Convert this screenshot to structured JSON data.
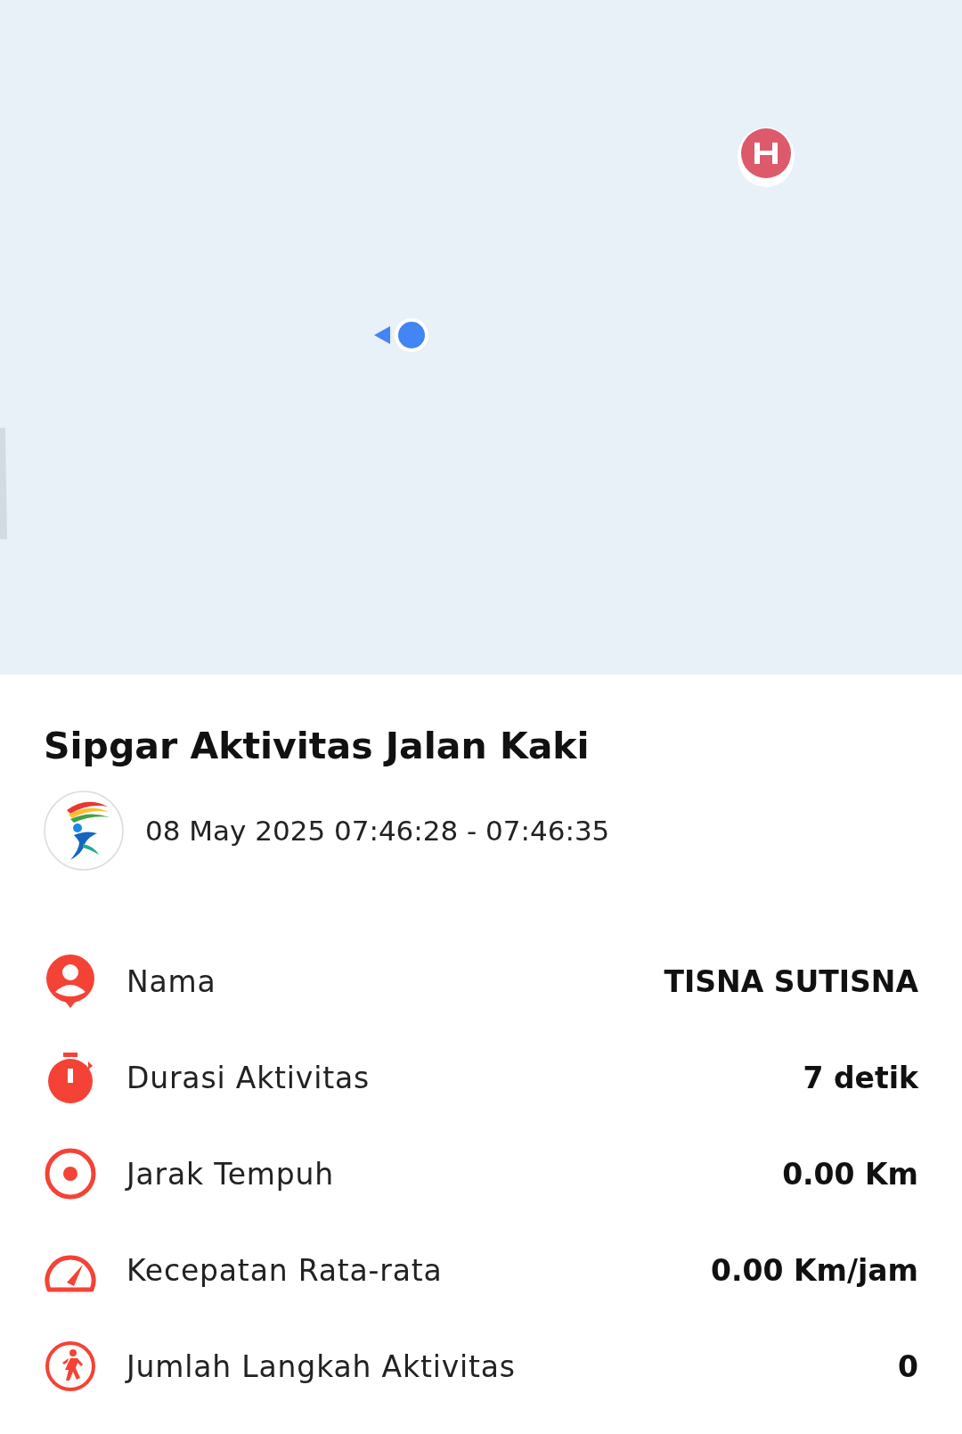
{
  "activity": {
    "title": "Sipgar Aktivitas Jalan Kaki",
    "time_range": "08 May 2025 07:46:28 - 07:46:35"
  },
  "stats": [
    {
      "kind": "person",
      "label": "Nama",
      "value": "TISNA SUTISNA"
    },
    {
      "kind": "timer",
      "label": "Durasi Aktivitas",
      "value": "7 detik"
    },
    {
      "kind": "distance",
      "label": "Jarak Tempuh",
      "value": "0.00 Km"
    },
    {
      "kind": "speed",
      "label": "Kecepatan Rata-rata",
      "value": "0.00 Km/jam"
    },
    {
      "kind": "steps",
      "label": "Jumlah Langkah Aktivitas",
      "value": "0"
    }
  ]
}
